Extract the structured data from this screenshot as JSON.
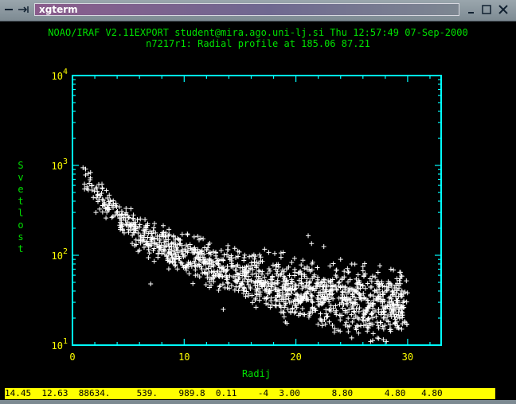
{
  "window": {
    "title": "xgterm",
    "menu_icon": "window-menu-icon",
    "shade_icon": "shade-icon",
    "minimize_icon": "minimize-icon",
    "maximize_icon": "maximize-icon",
    "close_icon": "close-icon"
  },
  "terminal": {
    "header_line1": "NOAO/IRAF V2.11EXPORT student@mira.ago.uni-lj.si Thu 12:57:49 07-Sep-2000",
    "header_line2": "n7217r1: Radial profile at 185.06 87.21",
    "status_line": "14.45  12.63  88634.     539.    989.8  0.11    -4  3.00      8.80      4.80   4.80"
  },
  "colors": {
    "text_green": "#00e000",
    "tick_yellow": "#ffff00",
    "axes_cyan": "#00ffff",
    "points_white": "#ffffff",
    "background": "#000000",
    "status_bg": "#ffff00"
  },
  "chart_data": {
    "type": "scatter",
    "title": "n7217r1: Radial profile at 185.06 87.21",
    "xlabel": "Radij",
    "ylabel": "Svetlost",
    "xlim": [
      0,
      33
    ],
    "ylim": [
      10,
      10000
    ],
    "y_scale": "log",
    "x_ticks": [
      "0",
      "10",
      "20",
      "30"
    ],
    "y_ticks": [
      {
        "base": "10",
        "exp": "1"
      },
      {
        "base": "10",
        "exp": "2"
      },
      {
        "base": "10",
        "exp": "3"
      },
      {
        "base": "10",
        "exp": "4"
      }
    ],
    "marker": "+",
    "profile": {
      "x": [
        0.8,
        1,
        2,
        3,
        4,
        5,
        6,
        7,
        8,
        10,
        12,
        14,
        16,
        18,
        20,
        22,
        24,
        26,
        28,
        30
      ],
      "y": [
        800,
        750,
        560,
        390,
        280,
        215,
        175,
        148,
        130,
        100,
        80,
        65,
        55,
        47,
        40,
        36,
        33,
        31,
        29,
        27
      ]
    },
    "outliers": [
      {
        "x": 21.1,
        "y": 165
      },
      {
        "x": 21.4,
        "y": 135
      },
      {
        "x": 22.5,
        "y": 125
      },
      {
        "x": 7.0,
        "y": 48
      },
      {
        "x": 2.1,
        "y": 300
      },
      {
        "x": 3.0,
        "y": 260
      },
      {
        "x": 11.0,
        "y": 60
      },
      {
        "x": 13.5,
        "y": 25
      },
      {
        "x": 25.0,
        "y": 80
      },
      {
        "x": 26.0,
        "y": 75
      },
      {
        "x": 28.5,
        "y": 70
      },
      {
        "x": 24.0,
        "y": 90
      }
    ]
  }
}
